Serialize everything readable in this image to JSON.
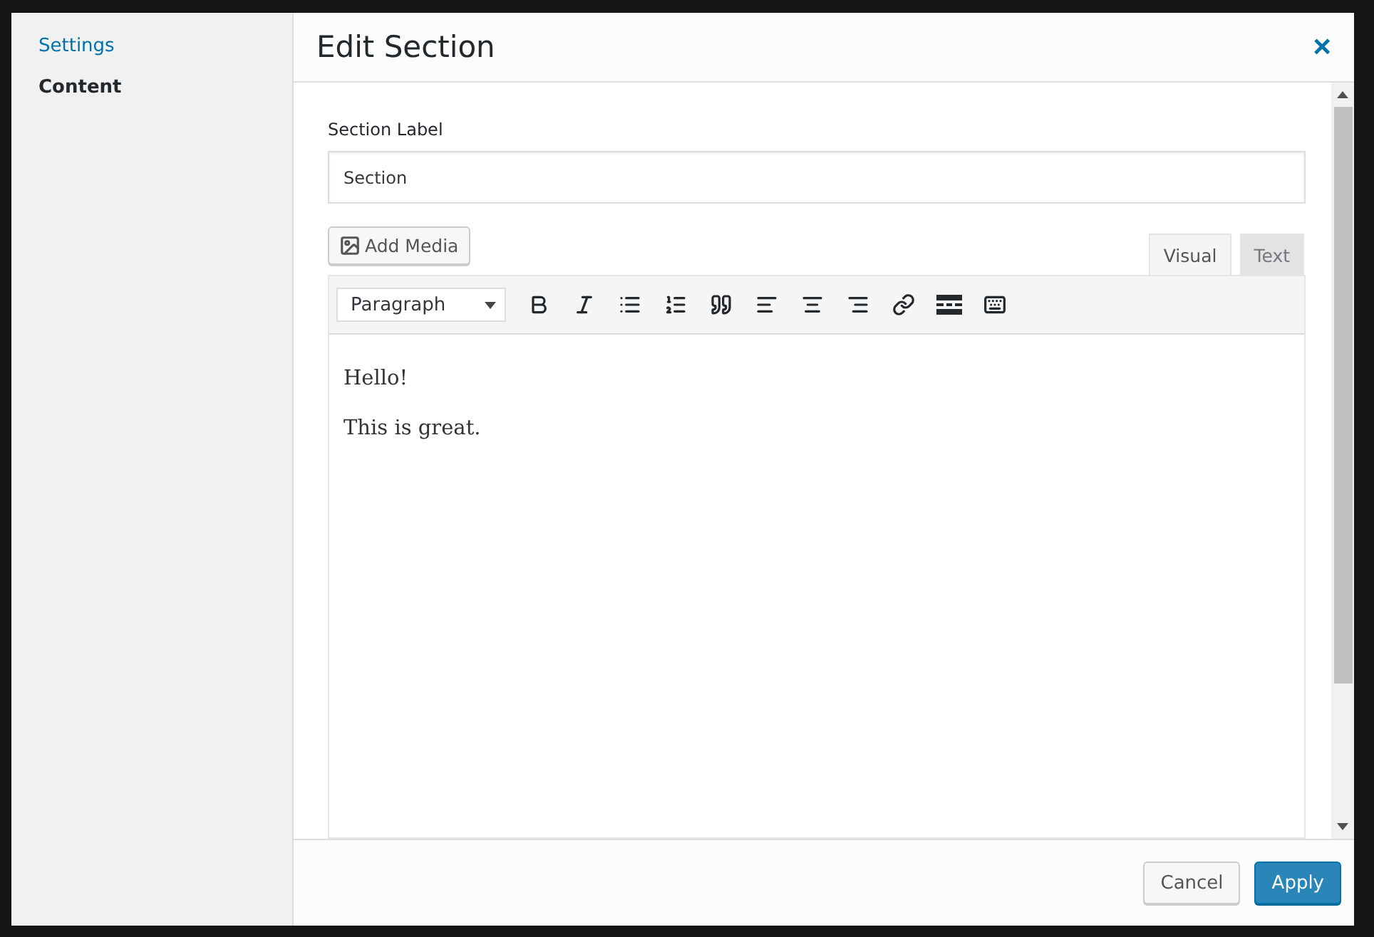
{
  "sidebar": {
    "items": [
      {
        "label": "Settings",
        "selected": false
      },
      {
        "label": "Content",
        "selected": true
      }
    ]
  },
  "dialog": {
    "title": "Edit Section",
    "close": "×"
  },
  "section_label": {
    "label": "Section Label",
    "value": "Section"
  },
  "add_media": "Add Media",
  "editor_tabs": [
    {
      "label": "Visual",
      "selected": true
    },
    {
      "label": "Text",
      "selected": false
    }
  ],
  "format_select": "Paragraph",
  "content": [
    "Hello!",
    "This is great."
  ],
  "buttons": [
    {
      "label": "Cancel",
      "kind": "secondary"
    },
    {
      "label": "Apply",
      "kind": "primary"
    }
  ]
}
